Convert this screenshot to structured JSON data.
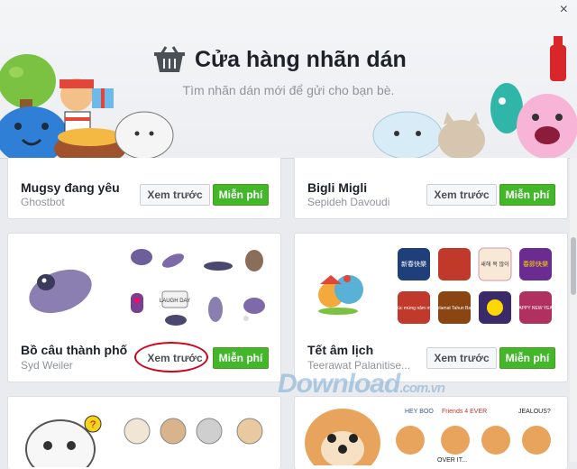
{
  "store": {
    "title": "Cửa hàng nhãn dán",
    "subtitle": "Tìm nhãn dán mới để gửi cho bạn bè.",
    "close": "×"
  },
  "packs": [
    {
      "name": "Mugsy đang yêu",
      "author": "Ghostbot",
      "preview_label": "Xem trước",
      "free_label": "Miễn phí"
    },
    {
      "name": "Bigli Migli",
      "author": "Sepideh Davoudi",
      "preview_label": "Xem trước",
      "free_label": "Miễn phí"
    },
    {
      "name": "Bồ câu thành phố",
      "author": "Syd Weiler",
      "preview_label": "Xem trước",
      "free_label": "Miễn phí"
    },
    {
      "name": "Tết âm lịch",
      "author": "Teerawat Palanitise...",
      "preview_label": "Xem trước",
      "free_label": "Miễn phí"
    }
  ],
  "sticker_texts": {
    "pigeon_sign": "LAUGH DAY",
    "tet_1": "新春快樂",
    "tet_2": "새해 복 많이",
    "tet_3": "春節快樂",
    "tet_4": "chúc mừng năm mới",
    "tet_5": "Selamat Tahun Baru",
    "tet_6": "HAPPY NEW YEAR",
    "dog_1": "HEY BOO",
    "dog_2": "Friends 4 EVER",
    "dog_3": "JEALOUS?",
    "dog_4": "OVER IT..."
  },
  "watermark": {
    "main": "Download",
    "suffix": ".com.vn"
  },
  "colors": {
    "accent_green": "#42b72a",
    "highlight_circle": "#d0021b",
    "title_text": "#1d2129"
  }
}
